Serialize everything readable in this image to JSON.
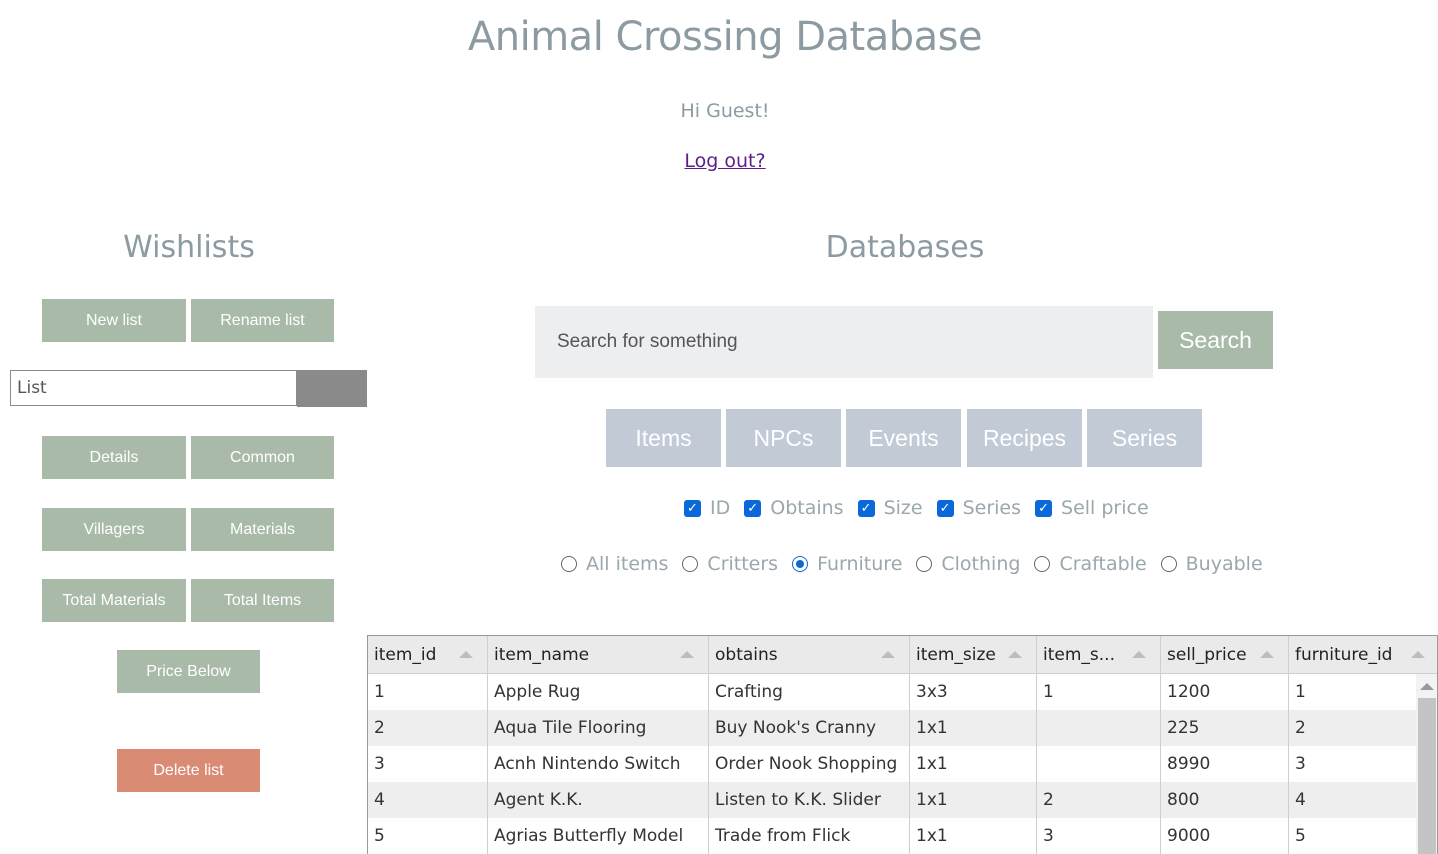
{
  "header": {
    "title": "Animal Crossing Database",
    "greeting": "Hi Guest!",
    "logout": "Log out?"
  },
  "wishlists": {
    "heading": "Wishlists",
    "new_list": "New list",
    "rename_list": "Rename list",
    "list_value": "List",
    "details": "Details",
    "common": "Common",
    "villagers": "Villagers",
    "materials": "Materials",
    "total_materials": "Total Materials",
    "total_items": "Total Items",
    "price_below": "Price Below",
    "delete_list": "Delete list"
  },
  "databases": {
    "heading": "Databases",
    "search_placeholder": "Search for something",
    "search_button": "Search",
    "tabs": [
      "Items",
      "NPCs",
      "Events",
      "Recipes",
      "Series"
    ],
    "checkboxes": [
      {
        "label": "ID",
        "checked": true
      },
      {
        "label": "Obtains",
        "checked": true
      },
      {
        "label": "Size",
        "checked": true
      },
      {
        "label": "Series",
        "checked": true
      },
      {
        "label": "Sell price",
        "checked": true
      }
    ],
    "radios": [
      {
        "label": "All items",
        "selected": false
      },
      {
        "label": "Critters",
        "selected": false
      },
      {
        "label": "Furniture",
        "selected": true
      },
      {
        "label": "Clothing",
        "selected": false
      },
      {
        "label": "Craftable",
        "selected": false
      },
      {
        "label": "Buyable",
        "selected": false
      }
    ]
  },
  "table": {
    "columns": [
      "item_id",
      "item_name",
      "obtains",
      "item_size",
      "item_s...",
      "sell_price",
      "furniture_id"
    ],
    "rows": [
      [
        "1",
        "Apple Rug",
        "Crafting",
        "3x3",
        "1",
        "1200",
        "1"
      ],
      [
        "2",
        "Aqua Tile Flooring",
        "Buy Nook's Cranny",
        "1x1",
        "",
        "225",
        "2"
      ],
      [
        "3",
        "Acnh Nintendo Switch",
        "Order Nook Shopping",
        "1x1",
        "",
        "8990",
        "3"
      ],
      [
        "4",
        "Agent K.K.",
        "Listen to K.K. Slider",
        "1x1",
        "2",
        "800",
        "4"
      ],
      [
        "5",
        "Agrias Butterfly Model",
        "Trade from Flick",
        "1x1",
        "3",
        "9000",
        "5"
      ]
    ]
  },
  "colors": {
    "green_button": "#a9bba8",
    "delete_button": "#d98b74",
    "tab": "#c2cad6",
    "heading_text": "#8c9ba2"
  }
}
